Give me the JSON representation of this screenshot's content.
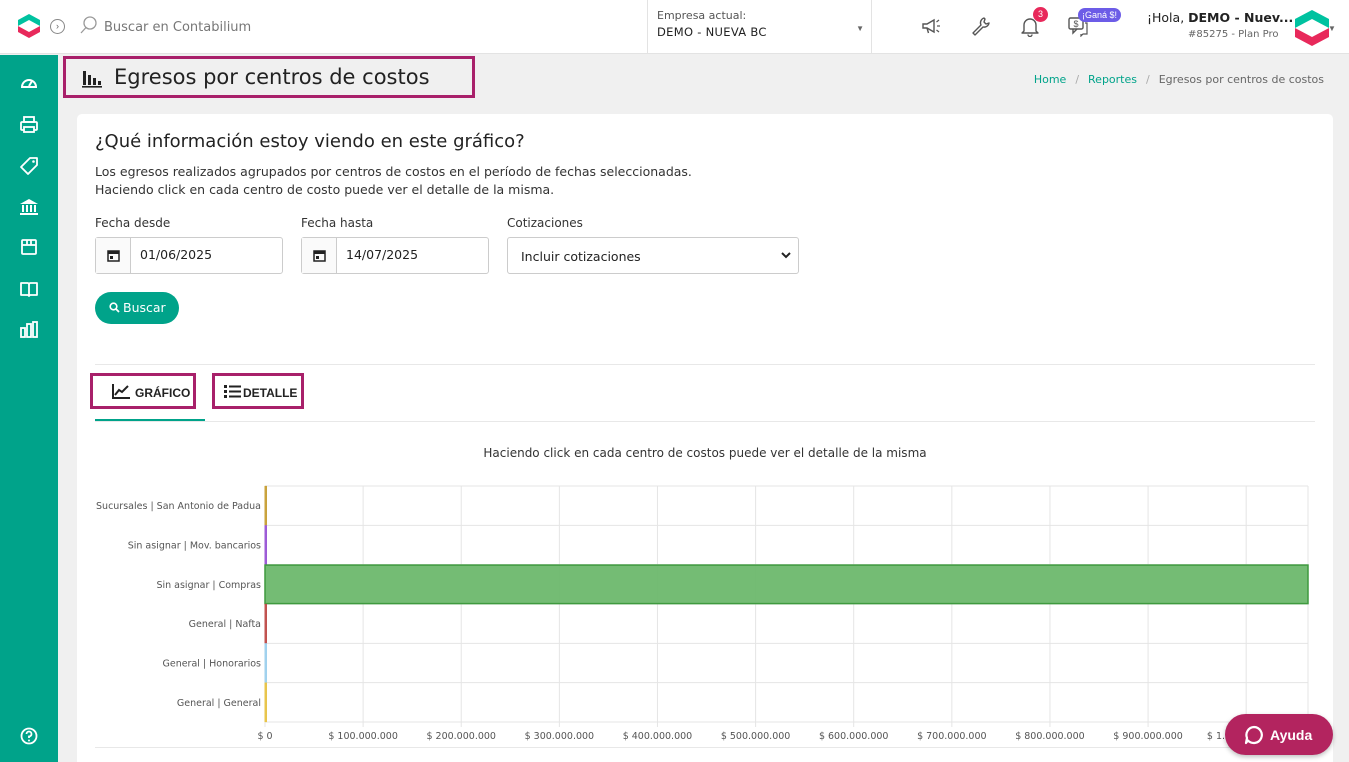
{
  "topbar": {
    "search_placeholder": "Buscar en Contabilium",
    "company_label": "Empresa actual:",
    "company_value": "DEMO - NUEVA BC",
    "notifications_count": "3",
    "promo_badge": "¡Ganá $!",
    "greeting_prefix": "¡Hola, ",
    "greeting_name": "DEMO - Nuev...",
    "plan_info": "#85275 - Plan Pro",
    "icons": [
      "megaphone-icon",
      "wrench-icon",
      "bell-icon",
      "referral-icon"
    ]
  },
  "sidebar": {
    "items": [
      "dashboard-icon",
      "printer-icon",
      "tag-icon",
      "bank-icon",
      "box-icon",
      "book-icon",
      "reports-icon",
      "help-circle-icon"
    ]
  },
  "page": {
    "title": "Egresos por centros de costos",
    "breadcrumb": [
      "Home",
      "Reportes",
      "Egresos por centros de costos"
    ]
  },
  "info": {
    "question": "¿Qué información estoy viendo en este gráfico?",
    "line1": "Los egresos realizados agrupados por centros de costos en el período de fechas seleccionadas.",
    "line2": "Haciendo click en cada centro de costo puede ver el detalle de la misma."
  },
  "filters": {
    "from_label": "Fecha desde",
    "from_value": "01/06/2025",
    "to_label": "Fecha hasta",
    "to_value": "14/07/2025",
    "quotes_label": "Cotizaciones",
    "quotes_value": "Incluir cotizaciones",
    "search_button": "Buscar"
  },
  "tabs": {
    "chart": "GRÁFICO",
    "detail": "DETALLE"
  },
  "chart_note": "Haciendo click en cada centro de costos puede ver el detalle de la misma",
  "chart_data": {
    "type": "bar",
    "orientation": "horizontal",
    "categories": [
      "Sucursales | San Antonio de Padua",
      "Sin asignar | Mov. bancarios",
      "Sin asignar | Compras",
      "General | Nafta",
      "General | Honorarios",
      "General | General"
    ],
    "values": [
      1000,
      1000,
      1063000000,
      1000,
      1000,
      1000
    ],
    "colors": [
      "#c8a13a",
      "#9b59d6",
      "#6db86d",
      "#c0504d",
      "#9fd1ee",
      "#e8c44a"
    ],
    "x_ticks": [
      "$ 0",
      "$ 100.000.000",
      "$ 200.000.000",
      "$ 300.000.000",
      "$ 400.000.000",
      "$ 500.000.000",
      "$ 600.000.000",
      "$ 700.000.000",
      "$ 800.000.000",
      "$ 900.000.000",
      "$ 1.000.000.000"
    ],
    "xlim": [
      0,
      1063000000
    ],
    "grid": true,
    "legend": "none"
  },
  "help": {
    "label": "Ayuda"
  }
}
